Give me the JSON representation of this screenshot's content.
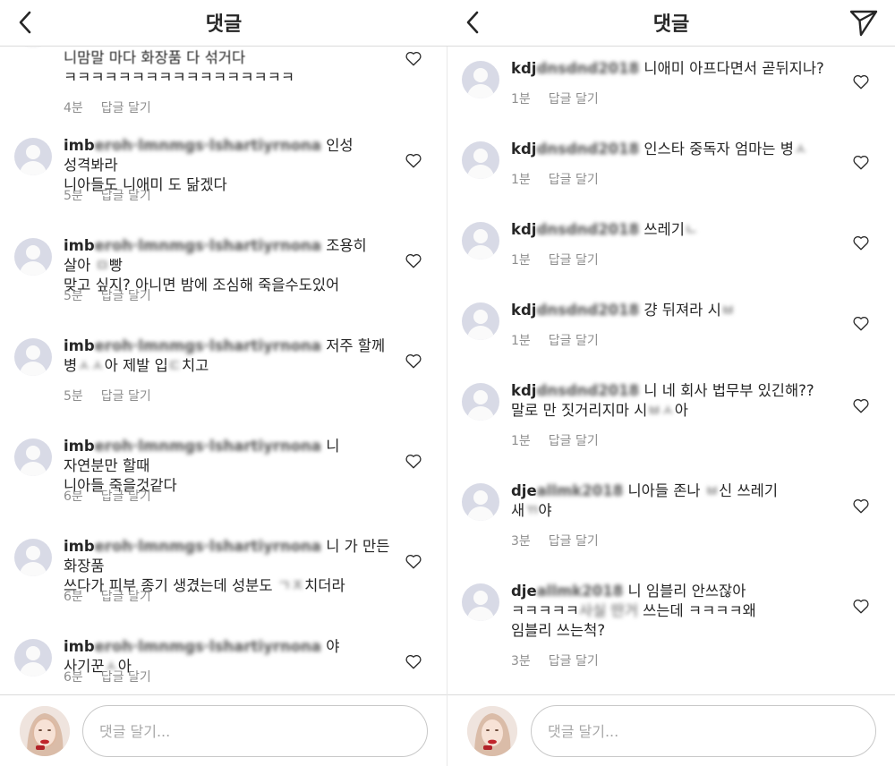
{
  "left": {
    "header": {
      "title": "댓글"
    },
    "comments": [
      {
        "username": "",
        "blurred_username": "",
        "text": "니맘말 마다 화장품 다 섞거다\nㅋㅋㅋㅋㅋㅋㅋㅋㅋㅋㅋㅋㅋㅋㅋㅋㅋ",
        "time": "4분",
        "reply_label": "답글 달기"
      },
      {
        "username": "imb",
        "blurred_username": "eroh·lmnmgs·lshartiyrnona",
        "text": "인성 성격봐라\n니아들도 니애미 도 닮겠다",
        "time": "5분",
        "reply_label": "답글 달기"
      },
      {
        "username": "imb",
        "blurred_username": "eroh·lmnmgs·lshartiyrnona",
        "text": "조용히 살아 [blur]빵\n맞고 싶지? 아니면 밤에 조심해 죽을수도있어",
        "time": "5분",
        "reply_label": "답글 달기"
      },
      {
        "username": "imb",
        "blurred_username": "eroh·lmnmgs·lshartiyrnona",
        "text": "저주 할께\n병[blur]아 제발 입[blur]치고",
        "time": "5분",
        "reply_label": "답글 달기"
      },
      {
        "username": "imb",
        "blurred_username": "eroh·lmnmgs·lshartiyrnona",
        "text": "니 자연분만 할때\n니아들 죽을것같다",
        "time": "6분",
        "reply_label": "답글 달기"
      },
      {
        "username": "imb",
        "blurred_username": "eroh·lmnmgs·lshartiyrnona",
        "text": "니 가 만든 화장품\n쓰다가 피부 종기 생겼는데 성분도 [blur]치더라",
        "time": "6분",
        "reply_label": "답글 달기"
      },
      {
        "username": "imb",
        "blurred_username": "eroh·lmnmgs·lshartiyrnona",
        "text": "야 사기꾼[blur]아",
        "time": "6분",
        "reply_label": "답글 달기"
      }
    ],
    "input": {
      "placeholder": "댓글 달기..."
    }
  },
  "right": {
    "header": {
      "title": "댓글"
    },
    "comments": [
      {
        "username": "kdj",
        "blurred_username": "dnsdnd2018",
        "text": "니애미 아프다면서 곧뒤지나?",
        "time": "1분",
        "reply_label": "답글 달기"
      },
      {
        "username": "kdj",
        "blurred_username": "dnsdnd2018",
        "text": "인스타 중독자 엄마는 병[blur]",
        "time": "1분",
        "reply_label": "답글 달기"
      },
      {
        "username": "kdj",
        "blurred_username": "dnsdnd2018",
        "text": "쓰레기[blur]",
        "time": "1분",
        "reply_label": "답글 달기"
      },
      {
        "username": "kdj",
        "blurred_username": "dnsdnd2018",
        "text": "걍 뒤져라 시[blur]",
        "time": "1분",
        "reply_label": "답글 달기"
      },
      {
        "username": "kdj",
        "blurred_username": "dnsdnd2018",
        "text": "니 네 회사 법무부 있긴해??\n말로 만 짓거리지마 시[blur]아",
        "time": "1분",
        "reply_label": "답글 달기"
      },
      {
        "username": "dje",
        "blurred_username": "allmk2018",
        "text": "니아들 존나 [blur]신 쓰레기\n새[blur]야",
        "time": "3분",
        "reply_label": "답글 달기"
      },
      {
        "username": "dje",
        "blurred_username": "allmk2018",
        "text": "니 임블리 안쓰잖아\nㅋㅋㅋㅋㅋ[blur] 쓰는데 ㅋㅋㅋㅋ왜\n임블리 쓰는척?",
        "time": "3분",
        "reply_label": "답글 달기"
      }
    ],
    "input": {
      "placeholder": "댓글 달기..."
    }
  },
  "icons": {
    "back": "chevron-left-icon",
    "send": "paper-plane-icon",
    "like": "heart-outline-icon",
    "avatar": "default-avatar-icon"
  },
  "colors": {
    "text": "#262626",
    "meta": "#8e8e8e",
    "border": "#dbdbdb",
    "avatar_bg": "#d8dae6"
  }
}
